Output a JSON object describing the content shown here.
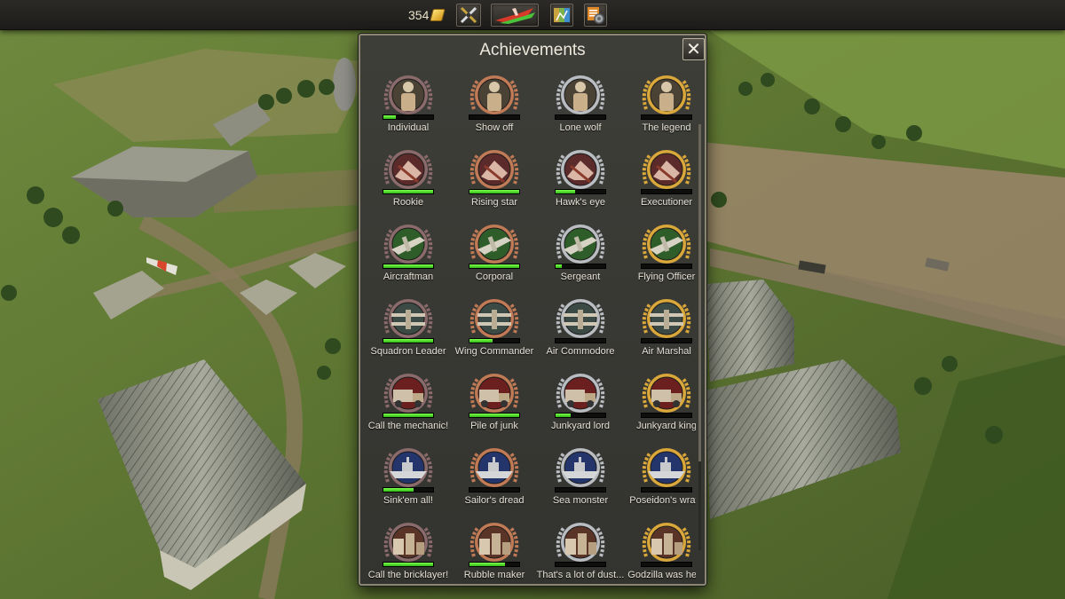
{
  "topbar": {
    "currency_value": "354",
    "buttons": [
      {
        "name": "weapons-button",
        "icon": "crossed-weapons-icon"
      },
      {
        "name": "aircraft-button",
        "icon": "aircraft-icon"
      },
      {
        "name": "map-button",
        "icon": "map-icon"
      },
      {
        "name": "settings-button",
        "icon": "gear-icon"
      }
    ]
  },
  "panel": {
    "title": "Achievements",
    "close_icon": "close-icon",
    "achievements": [
      {
        "name": "Individual",
        "tier": "bronze",
        "theme": "pilot",
        "progress": 0.25
      },
      {
        "name": "Show off",
        "tier": "copper",
        "theme": "pilot",
        "progress": 0
      },
      {
        "name": "Lone wolf",
        "tier": "silver",
        "theme": "pilot",
        "progress": 0
      },
      {
        "name": "The legend",
        "tier": "gold",
        "theme": "pilot",
        "progress": 0
      },
      {
        "name": "Rookie",
        "tier": "bronze",
        "theme": "wreck",
        "progress": 1
      },
      {
        "name": "Rising star",
        "tier": "copper",
        "theme": "wreck",
        "progress": 1
      },
      {
        "name": "Hawk's eye",
        "tier": "silver",
        "theme": "wreck",
        "progress": 0.4
      },
      {
        "name": "Executioner",
        "tier": "gold",
        "theme": "wreck",
        "progress": 0
      },
      {
        "name": "Aircraftman",
        "tier": "bronze",
        "theme": "plane-green",
        "progress": 1
      },
      {
        "name": "Corporal",
        "tier": "copper",
        "theme": "plane-green",
        "progress": 1
      },
      {
        "name": "Sergeant",
        "tier": "silver",
        "theme": "plane-green",
        "progress": 0.12
      },
      {
        "name": "Flying Officer",
        "tier": "gold",
        "theme": "plane-green",
        "progress": 0
      },
      {
        "name": "Squadron Leader",
        "tier": "bronze",
        "theme": "biplane",
        "progress": 1
      },
      {
        "name": "Wing Commander",
        "tier": "copper",
        "theme": "biplane",
        "progress": 0.47
      },
      {
        "name": "Air Commodore",
        "tier": "silver",
        "theme": "biplane",
        "progress": 0
      },
      {
        "name": "Air Marshal",
        "tier": "gold",
        "theme": "biplane",
        "progress": 0
      },
      {
        "name": "Call the mechanic!",
        "tier": "bronze",
        "theme": "truck",
        "progress": 1
      },
      {
        "name": "Pile of junk",
        "tier": "copper",
        "theme": "truck",
        "progress": 1
      },
      {
        "name": "Junkyard lord",
        "tier": "silver",
        "theme": "truck",
        "progress": 0.3
      },
      {
        "name": "Junkyard king",
        "tier": "gold",
        "theme": "truck",
        "progress": 0
      },
      {
        "name": "Sink'em all!",
        "tier": "bronze",
        "theme": "ship",
        "progress": 0.6
      },
      {
        "name": "Sailor's dread",
        "tier": "copper",
        "theme": "ship",
        "progress": 0
      },
      {
        "name": "Sea monster",
        "tier": "silver",
        "theme": "ship",
        "progress": 0
      },
      {
        "name": "Poseidon's wrath",
        "tier": "gold",
        "theme": "ship",
        "progress": 0
      },
      {
        "name": "Call the bricklayer!",
        "tier": "bronze",
        "theme": "building",
        "progress": 1
      },
      {
        "name": "Rubble maker",
        "tier": "copper",
        "theme": "building",
        "progress": 0.72
      },
      {
        "name": "That's a lot of dust...",
        "tier": "silver",
        "theme": "building",
        "progress": 0
      },
      {
        "name": "Godzilla was here",
        "tier": "gold",
        "theme": "building",
        "progress": 0
      }
    ]
  },
  "colors": {
    "tier_bronze": "#8a6a6a",
    "tier_copper": "#c07a55",
    "tier_silver": "#b9bcc0",
    "tier_gold": "#d9a73a",
    "progress_green": "#4fe02a"
  }
}
